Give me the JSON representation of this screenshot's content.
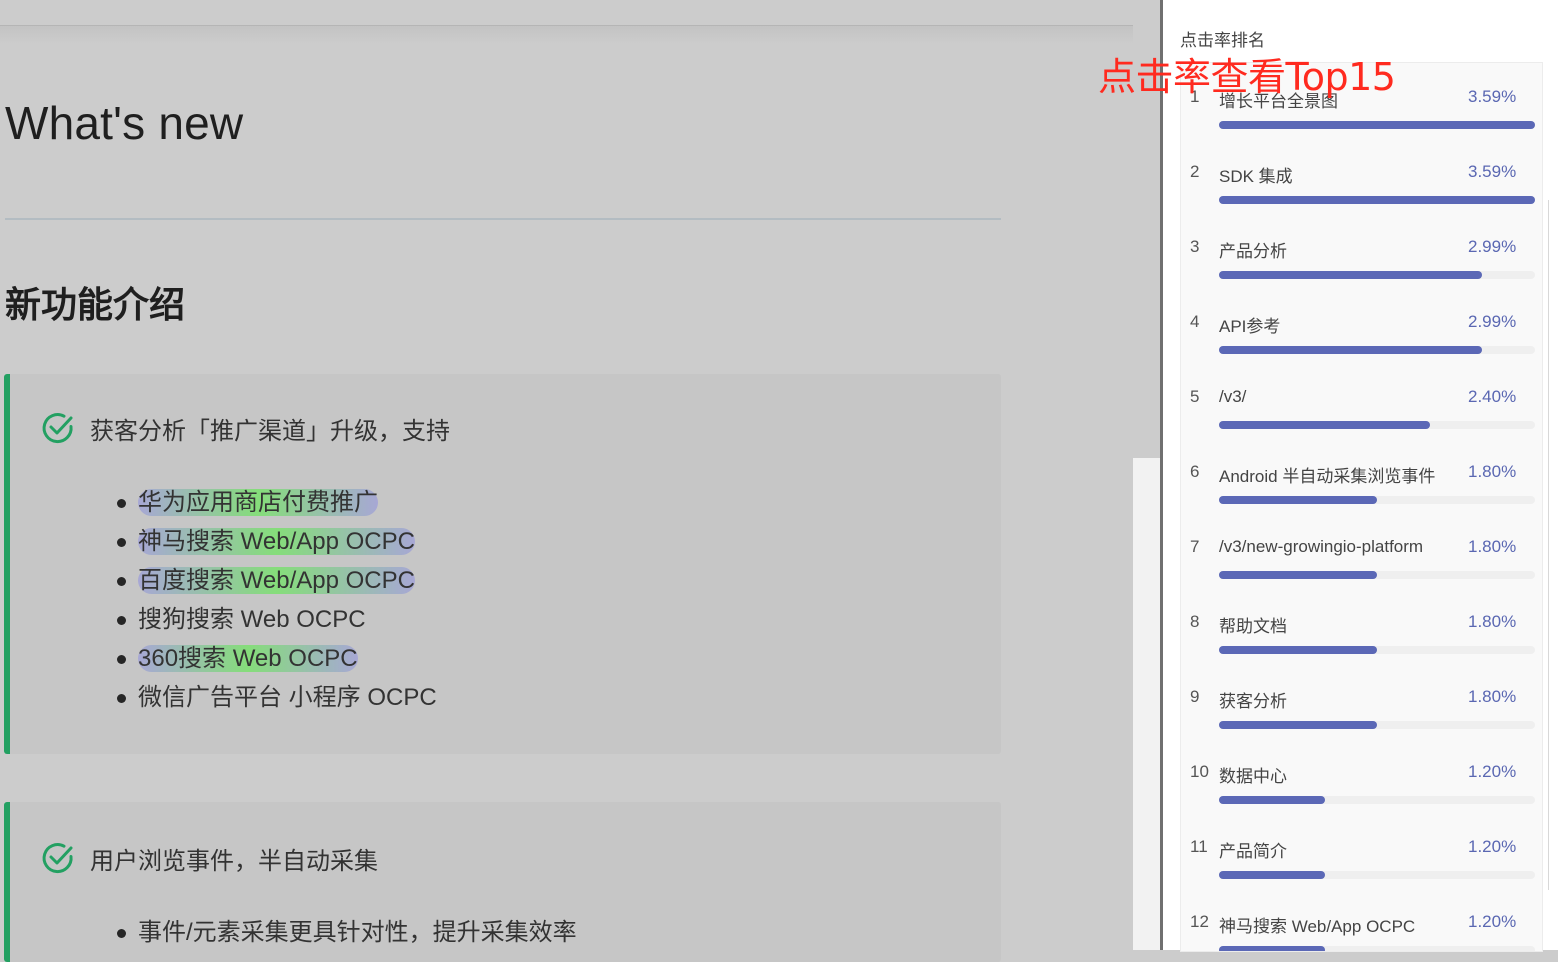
{
  "article": {
    "title": "What's new",
    "section_heading": "新功能介绍",
    "cards": [
      {
        "title": "获客分析「推广渠道」升级，支持",
        "items": [
          "华为应用商店付费推广",
          "神马搜索 Web/App OCPC",
          "百度搜索 Web/App OCPC",
          "搜狗搜索 Web OCPC",
          "360搜索 Web OCPC",
          "微信广告平台 小程序 OCPC"
        ]
      },
      {
        "title": "用户浏览事件，半自动采集",
        "items": [
          "事件/元素采集更具针对性，提升采集效率"
        ]
      }
    ],
    "accent_color": "#23a062"
  },
  "ranking": {
    "label": "点击率排名",
    "overlay_label": "点击率查看Top15",
    "bar_color": "#5b68b6",
    "items": [
      {
        "rank": "1",
        "name": "增长平台全景图",
        "percent": "3.59%",
        "value": 3.59
      },
      {
        "rank": "2",
        "name": "SDK 集成",
        "percent": "3.59%",
        "value": 3.59
      },
      {
        "rank": "3",
        "name": "产品分析",
        "percent": "2.99%",
        "value": 2.99
      },
      {
        "rank": "4",
        "name": "API参考",
        "percent": "2.99%",
        "value": 2.99
      },
      {
        "rank": "5",
        "name": "/v3/",
        "percent": "2.40%",
        "value": 2.4
      },
      {
        "rank": "6",
        "name": "Android 半自动采集浏览事件",
        "percent": "1.80%",
        "value": 1.8
      },
      {
        "rank": "7",
        "name": "/v3/new-growingio-platform",
        "percent": "1.80%",
        "value": 1.8
      },
      {
        "rank": "8",
        "name": "帮助文档",
        "percent": "1.80%",
        "value": 1.8
      },
      {
        "rank": "9",
        "name": "获客分析",
        "percent": "1.80%",
        "value": 1.8
      },
      {
        "rank": "10",
        "name": "数据中心",
        "percent": "1.20%",
        "value": 1.2
      },
      {
        "rank": "11",
        "name": "产品简介",
        "percent": "1.20%",
        "value": 1.2
      },
      {
        "rank": "12",
        "name": "神马搜索 Web/App OCPC",
        "percent": "1.20%",
        "value": 1.2
      }
    ]
  }
}
